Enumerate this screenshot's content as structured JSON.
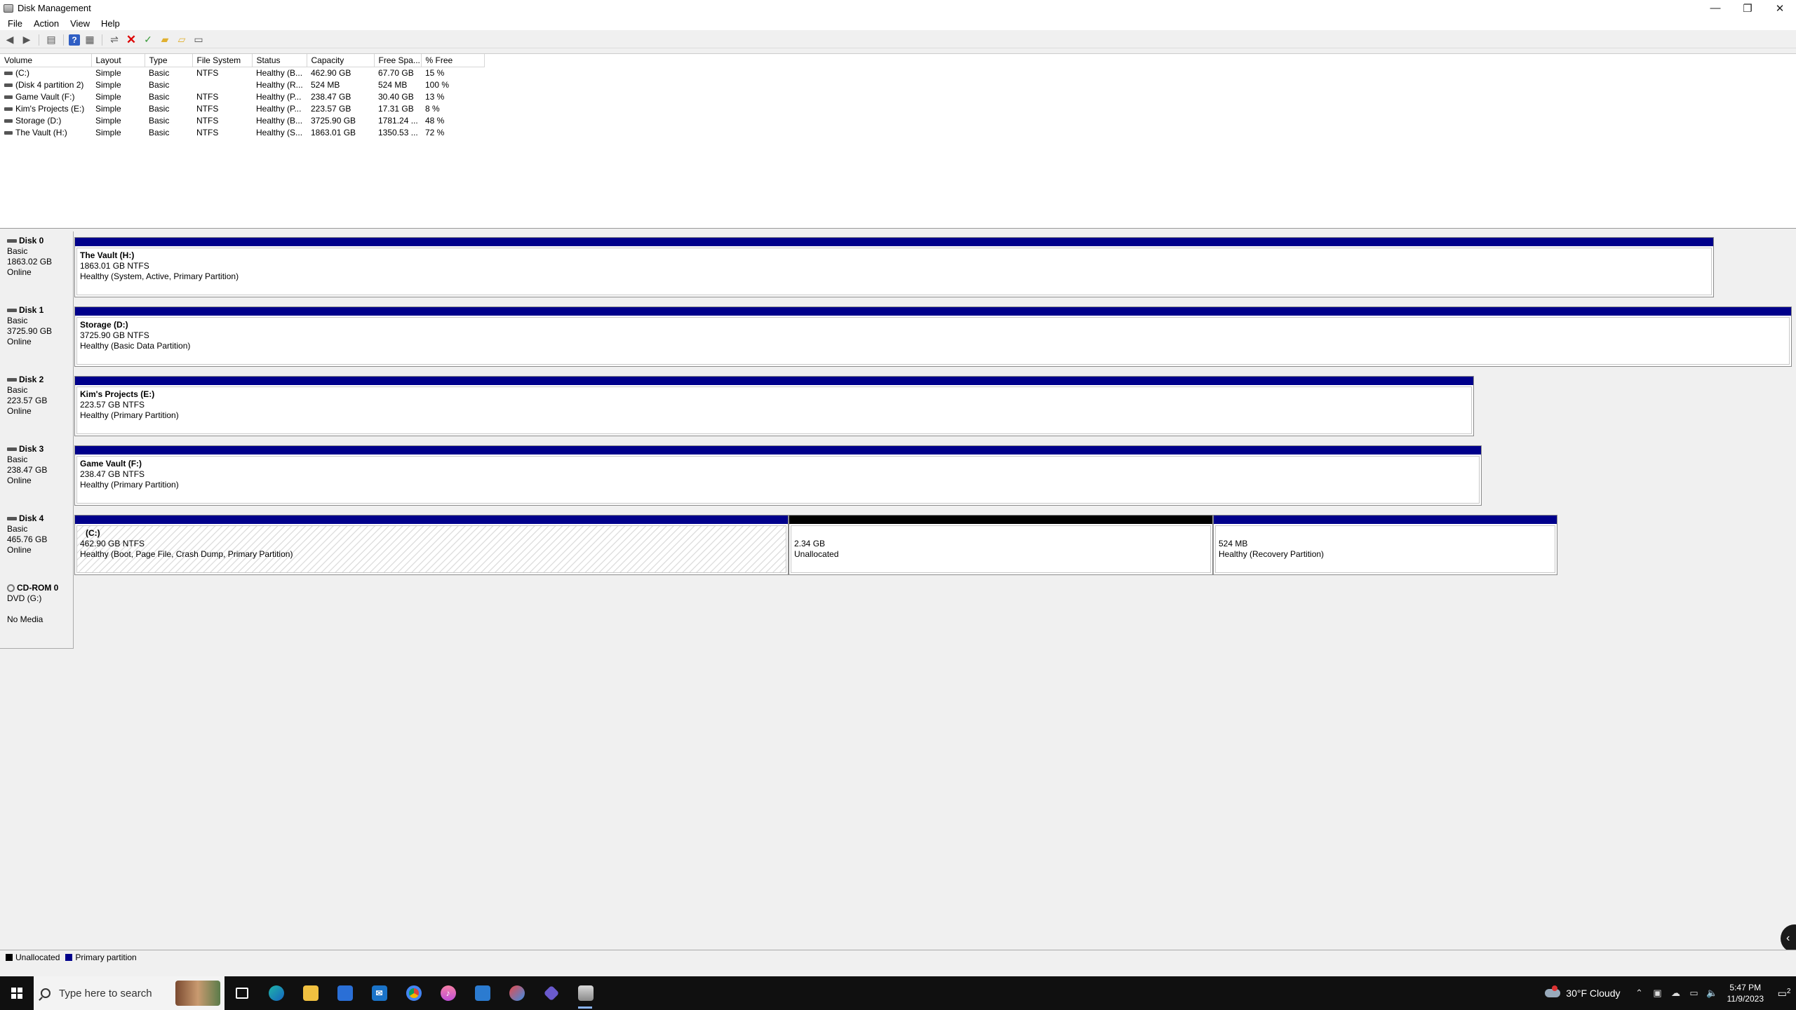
{
  "window": {
    "title": "Disk Management",
    "controls": {
      "minimize": "—",
      "restore": "❐",
      "close": "✕"
    }
  },
  "menu": [
    "File",
    "Action",
    "View",
    "Help"
  ],
  "columns": [
    "Volume",
    "Layout",
    "Type",
    "File System",
    "Status",
    "Capacity",
    "Free Spa...",
    "% Free"
  ],
  "volumes": [
    {
      "volume": "(C:)",
      "layout": "Simple",
      "type": "Basic",
      "fs": "NTFS",
      "status": "Healthy (B...",
      "capacity": "462.90 GB",
      "free": "67.70 GB",
      "pct": "15 %"
    },
    {
      "volume": "(Disk 4 partition 2)",
      "layout": "Simple",
      "type": "Basic",
      "fs": "",
      "status": "Healthy (R...",
      "capacity": "524 MB",
      "free": "524 MB",
      "pct": "100 %"
    },
    {
      "volume": "Game Vault (F:)",
      "layout": "Simple",
      "type": "Basic",
      "fs": "NTFS",
      "status": "Healthy (P...",
      "capacity": "238.47 GB",
      "free": "30.40 GB",
      "pct": "13 %"
    },
    {
      "volume": "Kim's Projects (E:)",
      "layout": "Simple",
      "type": "Basic",
      "fs": "NTFS",
      "status": "Healthy (P...",
      "capacity": "223.57 GB",
      "free": "17.31 GB",
      "pct": "8 %"
    },
    {
      "volume": "Storage (D:)",
      "layout": "Simple",
      "type": "Basic",
      "fs": "NTFS",
      "status": "Healthy (B...",
      "capacity": "3725.90 GB",
      "free": "1781.24 ...",
      "pct": "48 %"
    },
    {
      "volume": "The Vault (H:)",
      "layout": "Simple",
      "type": "Basic",
      "fs": "NTFS",
      "status": "Healthy (S...",
      "capacity": "1863.01 GB",
      "free": "1350.53 ...",
      "pct": "72 %"
    }
  ],
  "disks": [
    {
      "name": "Disk 0",
      "type": "Basic",
      "size": "1863.02 GB",
      "state": "Online",
      "partitions": [
        {
          "name": "The Vault  (H:)",
          "size": "1863.01 GB NTFS",
          "status": "Healthy (System, Active, Primary Partition)"
        }
      ]
    },
    {
      "name": "Disk 1",
      "type": "Basic",
      "size": "3725.90 GB",
      "state": "Online",
      "partitions": [
        {
          "name": "Storage  (D:)",
          "size": "3725.90 GB NTFS",
          "status": "Healthy (Basic Data Partition)"
        }
      ]
    },
    {
      "name": "Disk 2",
      "type": "Basic",
      "size": "223.57 GB",
      "state": "Online",
      "partitions": [
        {
          "name": "Kim's Projects  (E:)",
          "size": "223.57 GB NTFS",
          "status": "Healthy (Primary Partition)"
        }
      ]
    },
    {
      "name": "Disk 3",
      "type": "Basic",
      "size": "238.47 GB",
      "state": "Online",
      "partitions": [
        {
          "name": "Game Vault  (F:)",
          "size": "238.47 GB NTFS",
          "status": "Healthy (Primary Partition)"
        }
      ]
    },
    {
      "name": "Disk 4",
      "type": "Basic",
      "size": "465.76 GB",
      "state": "Online",
      "partitions": [
        {
          "name": "(C:)",
          "size": "462.90 GB NTFS",
          "status": "Healthy (Boot, Page File, Crash Dump, Primary Partition)"
        },
        {
          "name": "",
          "size": "2.34 GB",
          "status": "Unallocated"
        },
        {
          "name": "",
          "size": "524 MB",
          "status": "Healthy (Recovery Partition)"
        }
      ]
    },
    {
      "name": "CD-ROM 0",
      "type": "DVD (G:)",
      "size": "",
      "state": "No Media",
      "partitions": []
    }
  ],
  "legend": {
    "unallocated": "Unallocated",
    "primary": "Primary partition",
    "unallocated_color": "#000000",
    "primary_color": "#00008b"
  },
  "taskbar": {
    "search_placeholder": "Type here to search",
    "weather": "30°F  Cloudy",
    "time": "5:47 PM",
    "date": "11/9/2023",
    "notification_count": "2"
  }
}
